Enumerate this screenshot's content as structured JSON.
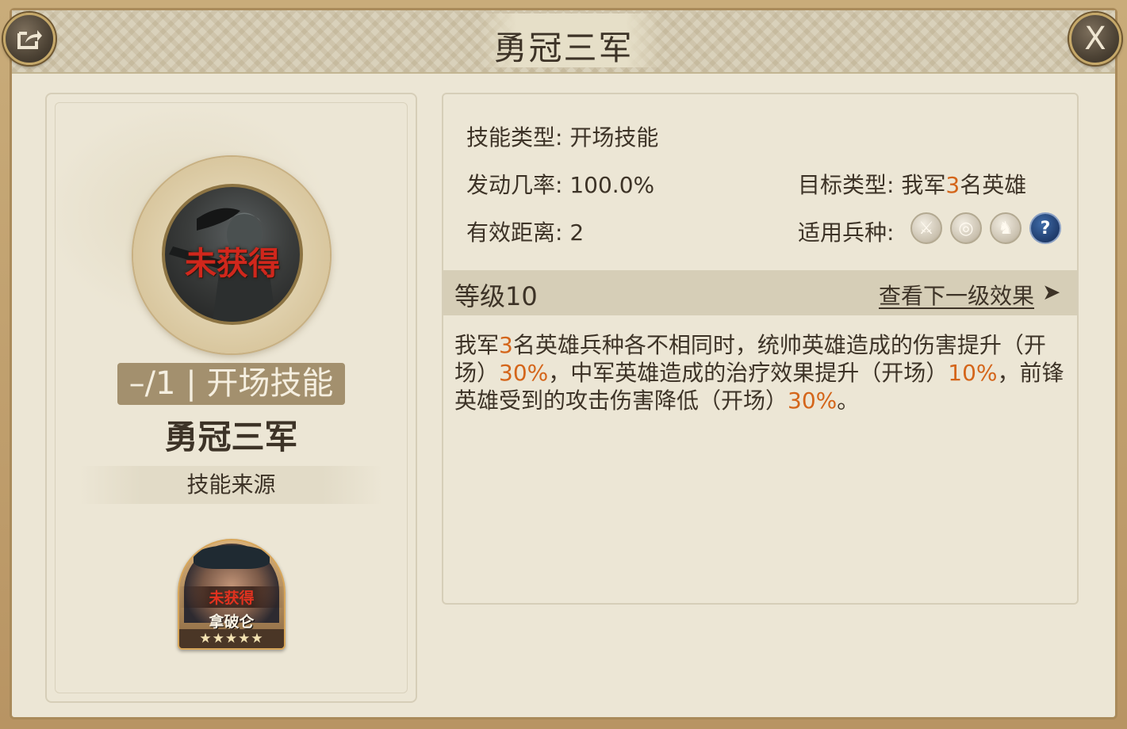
{
  "window": {
    "title": "勇冠三军",
    "share_icon": "share-icon",
    "close_label": "X"
  },
  "skill": {
    "status": "未获得",
    "tag": "–/1 | 开场技能",
    "name": "勇冠三军",
    "source_label": "技能来源"
  },
  "hero": {
    "status": "未获得",
    "name": "拿破仑",
    "stars": "★★★★★",
    "star_count": 5
  },
  "info": {
    "skill_type_label": "技能类型:",
    "skill_type_value": "开场技能",
    "trigger_rate_label": "发动几率:",
    "trigger_rate_value": "100.0%",
    "range_label": "有效距离:",
    "range_value": "2",
    "target_label": "目标类型:",
    "target_value_prefix": "我军",
    "target_value_number": "3",
    "target_value_suffix": "名英雄",
    "unit_label": "适用兵种:",
    "unit_icons": [
      "sword-icon",
      "target-icon",
      "horse-icon",
      "question-icon"
    ],
    "unit_icon_glyphs": [
      "⚔",
      "◎",
      "♞",
      "?"
    ]
  },
  "level": {
    "label": "等级10",
    "next_label": "查看下一级效果",
    "next_arrow": "➤"
  },
  "description": {
    "p1": "我军",
    "n1": "3",
    "p2": "名英雄兵种各不相同时，统帅英雄造成的伤害提升（开场）",
    "n2": "30%",
    "p3": "，中军英雄造成的治疗效果提升（开场）",
    "n3": "10%",
    "p4": "，前锋英雄受到的攻击伤害降低（开场）",
    "n4": "30%",
    "p5": "。"
  },
  "colors": {
    "highlight": "#d4651a",
    "not_obtained": "#d0271c",
    "text": "#3d3327"
  }
}
